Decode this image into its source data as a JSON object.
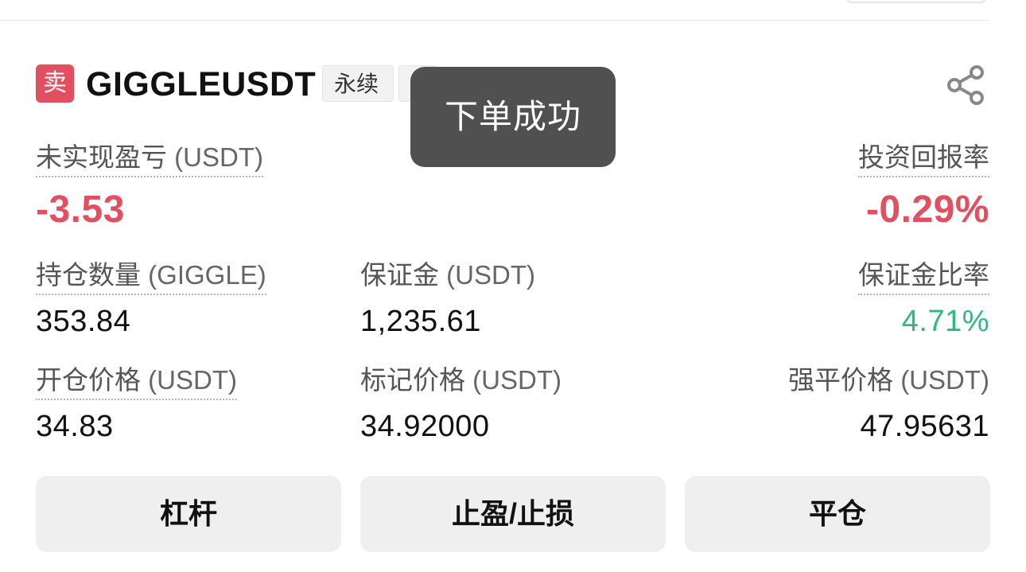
{
  "header": {
    "side_badge": "卖",
    "symbol": "GIGGLEUSDT",
    "tag_perpetual": "永续",
    "share_icon": "share-icon"
  },
  "toast": {
    "message": "下单成功"
  },
  "pnl": {
    "unrealized_label": "未实现盈亏",
    "unrealized_unit": "(USDT)",
    "unrealized_value": "-3.53",
    "roi_label": "投资回报率",
    "roi_value": "-0.29%"
  },
  "row1": {
    "position_size_label": "持仓数量",
    "position_size_unit": "(GIGGLE)",
    "position_size_value": "353.84",
    "margin_label": "保证金",
    "margin_unit": "(USDT)",
    "margin_value": "1,235.61",
    "margin_ratio_label": "保证金比率",
    "margin_ratio_value": "4.71%"
  },
  "row2": {
    "entry_price_label": "开仓价格",
    "entry_price_unit": "(USDT)",
    "entry_price_value": "34.83",
    "mark_price_label": "标记价格",
    "mark_price_unit": "(USDT)",
    "mark_price_value": "34.92000",
    "liq_price_label": "强平价格",
    "liq_price_unit": "(USDT)",
    "liq_price_value": "47.95631"
  },
  "actions": {
    "leverage_label": "杠杆",
    "tpsl_label": "止盈/止损",
    "close_label": "平仓"
  },
  "colors": {
    "sell": "#e2505f",
    "positive": "#2fb784",
    "toast_bg": "#505050"
  }
}
